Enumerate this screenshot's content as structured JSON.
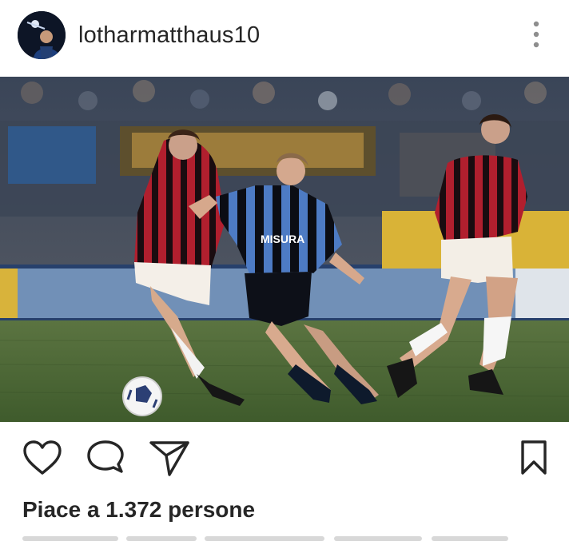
{
  "post": {
    "username": "lotharmatthaus10",
    "likes_text": "Piace a 1.372 persone"
  },
  "photo": {
    "jersey_text": "MISURA"
  },
  "icons": {
    "avatar": "profile-avatar",
    "more": "more-vertical-icon",
    "like": "heart-icon",
    "comment": "comment-bubble-icon",
    "share": "paper-plane-icon",
    "save": "bookmark-icon"
  },
  "colors": {
    "text": "#262626",
    "background": "#ffffff"
  }
}
